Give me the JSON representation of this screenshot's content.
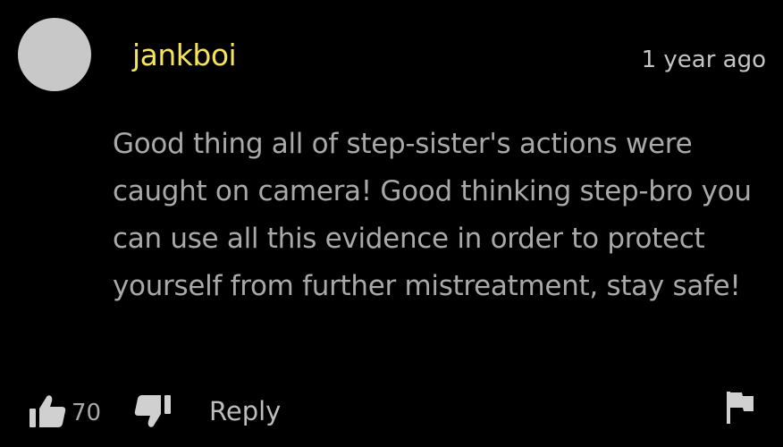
{
  "comment": {
    "author": "jankboi",
    "timestamp": "1 year ago",
    "text": "Good thing all of step-sister's actions were caught on camera! Good thinking step-bro you can use all this evidence in order to protect yourself from further mistreatment, stay safe!",
    "author_color": "#f3e45c",
    "text_color": "#a9a9a9"
  },
  "actions": {
    "like_icon": "thumbs-up-icon",
    "like_count": "70",
    "dislike_icon": "thumbs-down-icon",
    "reply_label": "Reply",
    "flag_icon": "flag-icon"
  }
}
